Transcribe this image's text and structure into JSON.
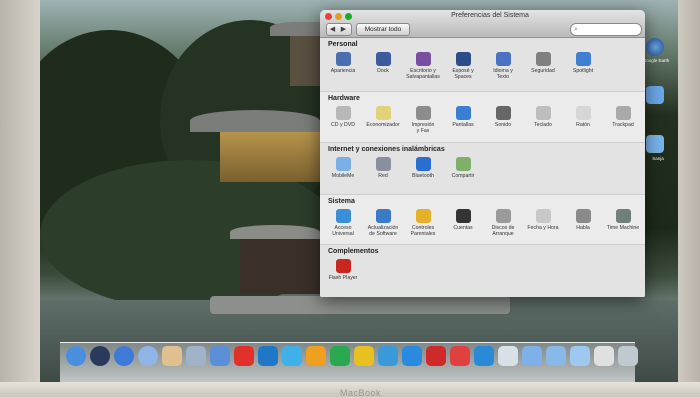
{
  "window": {
    "title": "Preferencias del Sistema",
    "show_all": "Mostrar todo",
    "nav_back": "◀",
    "nav_forward": "▶",
    "search_placeholder": ""
  },
  "sections": {
    "personal": {
      "title": "Personal",
      "items": [
        {
          "label1": "Apariencia",
          "label2": "",
          "icon": "appearance-icon",
          "color": "#4a6fb0"
        },
        {
          "label1": "Dock",
          "label2": "",
          "icon": "dock-icon",
          "color": "#3b5aa0"
        },
        {
          "label1": "Escritorio y",
          "label2": "Salvapantallas",
          "icon": "desktop-icon",
          "color": "#7a4ea0"
        },
        {
          "label1": "Exposé y",
          "label2": "Spaces",
          "icon": "expose-icon",
          "color": "#2d4d8a"
        },
        {
          "label1": "Idioma y",
          "label2": "Texto",
          "icon": "language-icon",
          "color": "#4b72c2"
        },
        {
          "label1": "Seguridad",
          "label2": "",
          "icon": "security-icon",
          "color": "#7f7f7f"
        },
        {
          "label1": "Spotlight",
          "label2": "",
          "icon": "spotlight-icon",
          "color": "#3f7fd0"
        }
      ]
    },
    "hardware": {
      "title": "Hardware",
      "items": [
        {
          "label1": "CD y DVD",
          "label2": "",
          "icon": "cd-icon",
          "color": "#b8b8b8"
        },
        {
          "label1": "Economizador",
          "label2": "",
          "icon": "energy-icon",
          "color": "#e2d27a"
        },
        {
          "label1": "Impresión",
          "label2": "y Fax",
          "icon": "printer-icon",
          "color": "#8c8c8c"
        },
        {
          "label1": "Pantallas",
          "label2": "",
          "icon": "displays-icon",
          "color": "#3a7ed4"
        },
        {
          "label1": "Sonido",
          "label2": "",
          "icon": "sound-icon",
          "color": "#666"
        },
        {
          "label1": "Teclado",
          "label2": "",
          "icon": "keyboard-icon",
          "color": "#bdbdbd"
        },
        {
          "label1": "Ratón",
          "label2": "",
          "icon": "mouse-icon",
          "color": "#d6d6d6"
        },
        {
          "label1": "Trackpad",
          "label2": "",
          "icon": "trackpad-icon",
          "color": "#a9a9a9"
        }
      ]
    },
    "internet": {
      "title": "Internet y conexiones inalámbricas",
      "items": [
        {
          "label1": "MobileMe",
          "label2": "",
          "icon": "mobileme-icon",
          "color": "#7ab0e6"
        },
        {
          "label1": "Red",
          "label2": "",
          "icon": "network-icon",
          "color": "#8a8fa0"
        },
        {
          "label1": "Bluetooth",
          "label2": "",
          "icon": "bluetooth-icon",
          "color": "#2a6fd0"
        },
        {
          "label1": "Compartir",
          "label2": "",
          "icon": "sharing-icon",
          "color": "#7fb06a"
        }
      ]
    },
    "sistema": {
      "title": "Sistema",
      "items": [
        {
          "label1": "Acceso",
          "label2": "Universal",
          "icon": "accessibility-icon",
          "color": "#3b8fd8"
        },
        {
          "label1": "Actualización",
          "label2": "de Software",
          "icon": "software-update-icon",
          "color": "#3a7ac8"
        },
        {
          "label1": "Controles",
          "label2": "Parentales",
          "icon": "parental-icon",
          "color": "#e5b02a"
        },
        {
          "label1": "Cuentas",
          "label2": "",
          "icon": "accounts-icon",
          "color": "#333"
        },
        {
          "label1": "Discos de",
          "label2": "Arranque",
          "icon": "startup-disk-icon",
          "color": "#9a9a9a"
        },
        {
          "label1": "Fecha y Hora",
          "label2": "",
          "icon": "date-time-icon",
          "color": "#c8c8c8"
        },
        {
          "label1": "Habla",
          "label2": "",
          "icon": "speech-icon",
          "color": "#8a8a8a"
        },
        {
          "label1": "Time Machine",
          "label2": "",
          "icon": "time-machine-icon",
          "color": "#6f7f7a"
        }
      ]
    },
    "complementos": {
      "title": "Complementos",
      "items": [
        {
          "label1": "Flash Player",
          "label2": "",
          "icon": "flash-icon",
          "color": "#c8261e"
        }
      ]
    }
  },
  "desktop_labels": {
    "google_earth": "Google Earth",
    "item2": "",
    "item3": "Sanja"
  },
  "bezel": {
    "brand": "MacBook"
  },
  "dock_colors": [
    "#4a8ee0",
    "#2a3a5a",
    "#3f7ad8",
    "#8fb5e8",
    "#e0c090",
    "#9fb2c8",
    "#5a8fd8",
    "#e0302a",
    "#1f77c8",
    "#3fb0e8",
    "#f0a020",
    "#2aa850",
    "#e8c020",
    "#3a9ad8",
    "#2a8ae0",
    "#cf2a2a",
    "#e04040",
    "#2a8ad8",
    "#d8e0e8",
    "#7fb0e8",
    "#88b8e8",
    "#9fc8f0",
    "#e0e0e0",
    "#c0c8d0"
  ]
}
